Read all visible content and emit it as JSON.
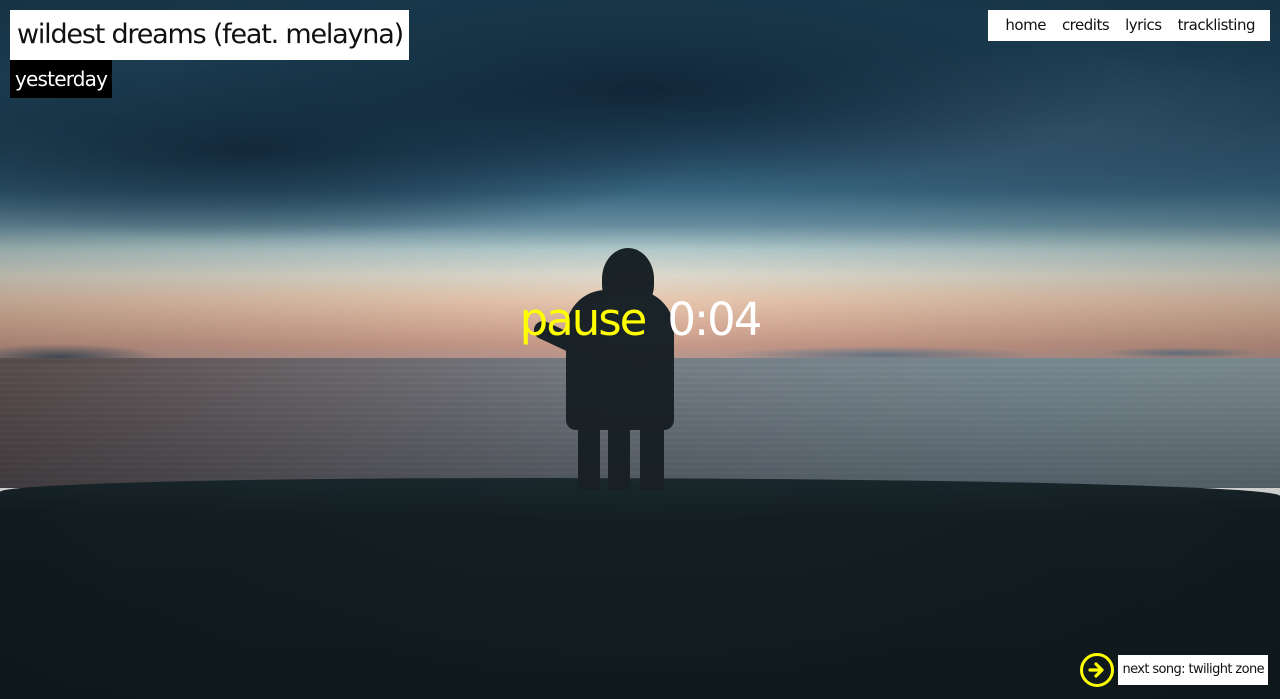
{
  "song": {
    "title": "wildest dreams (feat. melayna)",
    "album": "yesterday"
  },
  "nav": {
    "items": [
      {
        "label": "home"
      },
      {
        "label": "credits"
      },
      {
        "label": "lyrics"
      },
      {
        "label": "tracklisting"
      }
    ]
  },
  "player": {
    "pause_label": "pause",
    "time": "0:04"
  },
  "next": {
    "label": "next song: twilight zone",
    "icon": "arrow-right-circle-icon"
  },
  "colors": {
    "accent": "#ffff00",
    "title_bg": "#ffffff",
    "album_bg": "#000000",
    "time_text": "#ffffff"
  }
}
